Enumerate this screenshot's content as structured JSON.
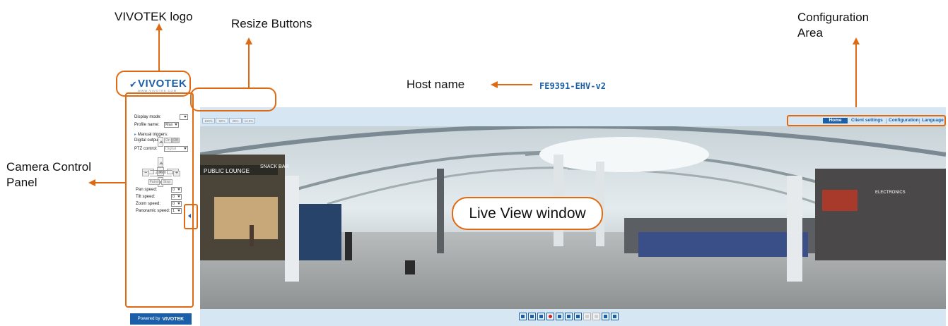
{
  "annotations": {
    "logo": "VIVOTEK logo",
    "resize": "Resize Buttons",
    "config_line1": "Configuration",
    "config_line2": "Area",
    "host": "Host name",
    "camera_line1": "Camera Control",
    "camera_line2": "Panel",
    "live_view": "Live View window",
    "accent_color": "#e06a12"
  },
  "header": {
    "logo_text": "VIVOTEK",
    "logo_sub": "WWW.VIVOTEK.COM",
    "host_name": "FE9391-EHV-v2",
    "brand_color": "#1b5fa8"
  },
  "menu": {
    "items": [
      "Home",
      "Client settings",
      "Configuration",
      "Language"
    ]
  },
  "resize_buttons": [
    "100%",
    "50%",
    "25%",
    "12.5%"
  ],
  "control_panel": {
    "display_mode_label": "Display mode:",
    "profile_name_label": "Profile name:",
    "profile_name_value": "Max",
    "manual_triggers_label": "Manual triggers:",
    "digital_output_label": "Digital output :",
    "on_label": "On",
    "off_label": "Off",
    "ptz_control_label": "PTZ control:",
    "ptz_control_value": "Digital",
    "zoom_label": "Zoom",
    "zoom_minus": "−",
    "zoom_plus": "+",
    "patrol_label": "Patrol",
    "stop_label": "Stop",
    "pan_speed_label": "Pan speed:",
    "pan_speed_value": "0",
    "tilt_speed_label": "Tilt speed:",
    "tilt_speed_value": "0",
    "zoom_speed_label": "Zoom speed:",
    "zoom_speed_value": "0",
    "panoramic_speed_label": "Panoramic speed:",
    "panoramic_speed_value": "1"
  },
  "footer": {
    "powered_by": "Powered by",
    "brand": "VIVOTEK"
  },
  "live_view": {
    "scene_sign_1": "PUBLIC LOUNGE",
    "scene_sign_2": "SNACK BAR",
    "scene_sign_3": "ELECTRONICS"
  },
  "toolbar": {
    "icons": [
      "snapshot-icon",
      "pause-icon",
      "stop-icon",
      "record-icon",
      "volume-icon",
      "mute-icon",
      "talk-icon",
      "mic-icon",
      "fullscreen-icon",
      "ptz-icon",
      "pip-icon"
    ]
  }
}
